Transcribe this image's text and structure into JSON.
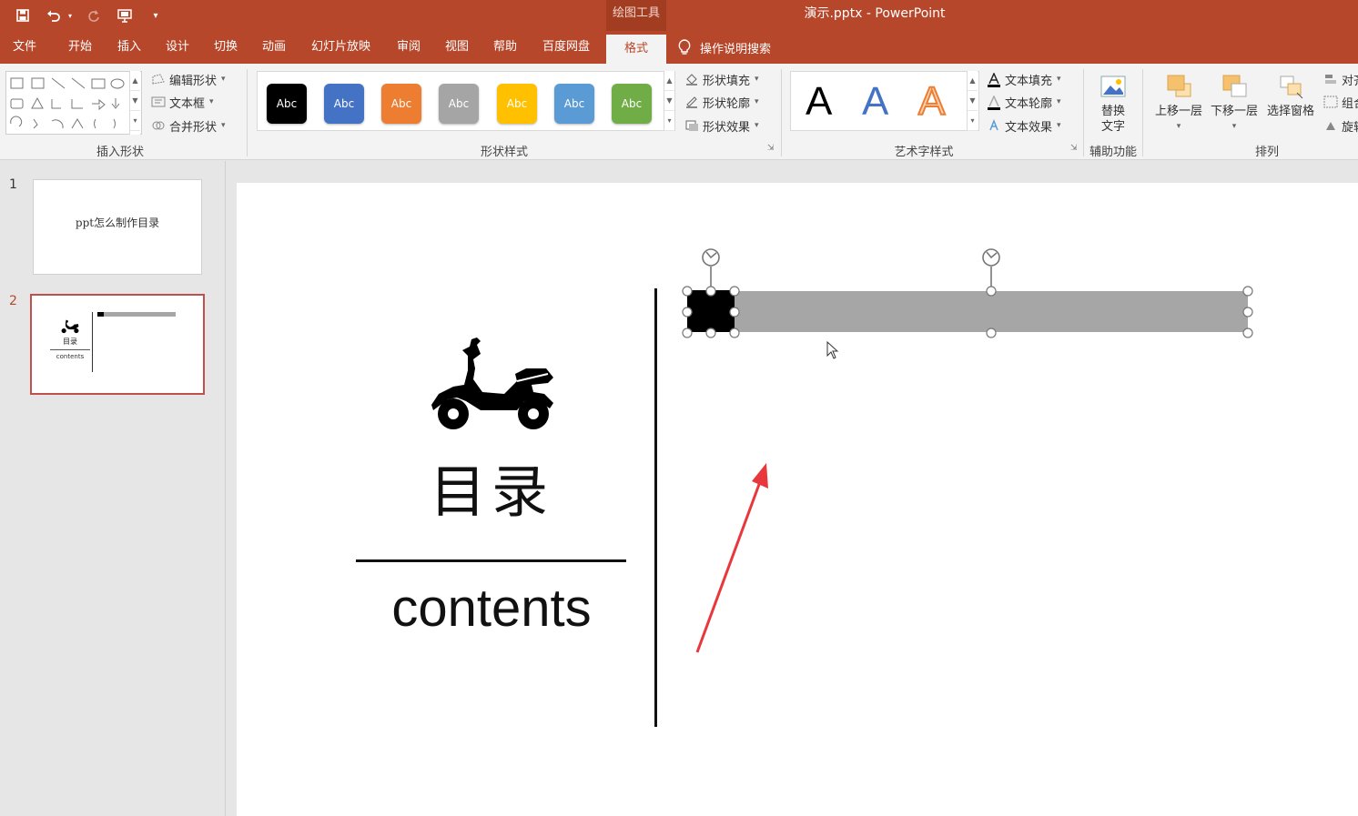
{
  "window": {
    "doc_title": "演示.pptx  -  PowerPoint",
    "context_tab": "绘图工具"
  },
  "quick_access": [
    "save-icon",
    "undo-icon",
    "redo-icon",
    "present-icon",
    "customize-icon"
  ],
  "tabs": [
    {
      "label": "文件"
    },
    {
      "label": "开始"
    },
    {
      "label": "插入"
    },
    {
      "label": "设计"
    },
    {
      "label": "切换"
    },
    {
      "label": "动画"
    },
    {
      "label": "幻灯片放映"
    },
    {
      "label": "审阅"
    },
    {
      "label": "视图"
    },
    {
      "label": "帮助"
    },
    {
      "label": "百度网盘"
    },
    {
      "label": "格式"
    }
  ],
  "active_tab": "格式",
  "tell_me": "操作说明搜索",
  "ribbon": {
    "insert_shapes": {
      "label": "插入形状",
      "edit_shape": "编辑形状",
      "text_box": "文本框",
      "merge_shapes": "合并形状"
    },
    "shape_styles": {
      "label": "形状样式",
      "swatch_text": "Abc",
      "swatch_colors": [
        "#000000",
        "#4472c4",
        "#ed7d31",
        "#a5a5a5",
        "#ffc000",
        "#5b9bd5",
        "#70ad47"
      ],
      "fill": "形状填充",
      "outline": "形状轮廓",
      "effects": "形状效果"
    },
    "wordart_styles": {
      "label": "艺术字样式",
      "sample": "A",
      "text_fill": "文本填充",
      "text_outline": "文本轮廓",
      "text_effects": "文本效果"
    },
    "accessibility": {
      "label": "辅助功能",
      "alt_text_line1": "替换",
      "alt_text_line2": "文字"
    },
    "arrange": {
      "label": "排列",
      "bring_forward": "上移一层",
      "send_backward": "下移一层",
      "selection_pane": "选择窗格",
      "align": "对齐",
      "group": "组合",
      "rotate": "旋转"
    }
  },
  "slides": [
    {
      "number": "1",
      "title": "ppt怎么制作目录"
    },
    {
      "number": "2",
      "title": "目录",
      "subtitle": "contents"
    }
  ],
  "slide_content": {
    "title": "目录",
    "subtitle": "contents",
    "icon": "scooter-icon"
  },
  "colors": {
    "accent": "#b7472a",
    "selected_bar": "#a6a6a6",
    "annotation_arrow": "#e8383d"
  }
}
